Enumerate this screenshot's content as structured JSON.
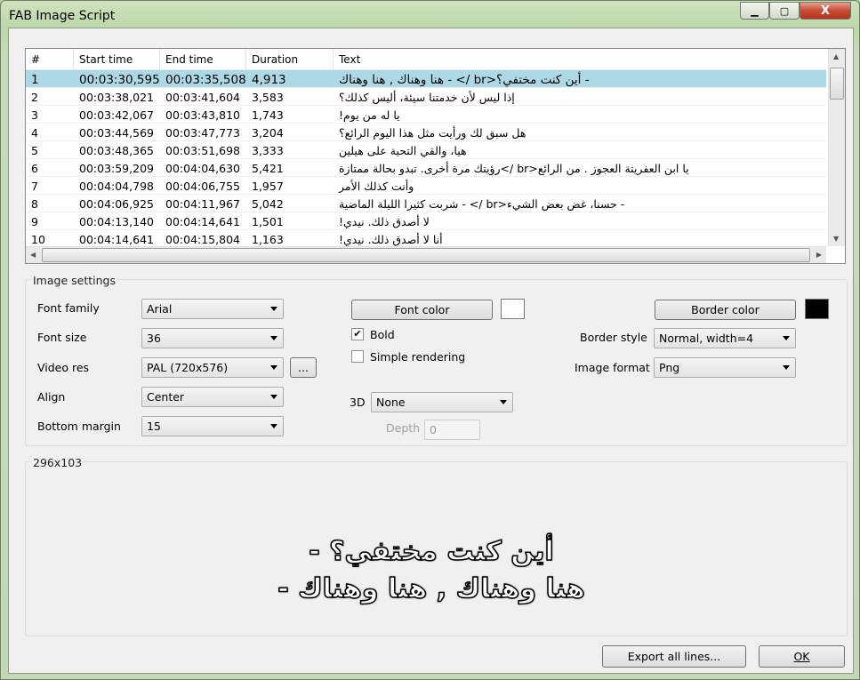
{
  "window": {
    "title": "FAB Image Script",
    "close_glyph": "X"
  },
  "list": {
    "columns": [
      "#",
      "Start time",
      "End time",
      "Duration",
      "Text"
    ],
    "rows": [
      {
        "n": "1",
        "start": "00:03:30,595",
        "end": "00:03:35,508",
        "dur": "4,913",
        "text": "- أين كنت مختفي؟<br /> - هنا وهناك , هنا وهناك"
      },
      {
        "n": "2",
        "start": "00:03:38,021",
        "end": "00:03:41,604",
        "dur": "3,583",
        "text": "إذا ليس لأن خدمتنا سيئة، أليس كذلك؟"
      },
      {
        "n": "3",
        "start": "00:03:42,067",
        "end": "00:03:43,810",
        "dur": "1,743",
        "text": "يا له من يوم!"
      },
      {
        "n": "4",
        "start": "00:03:44,569",
        "end": "00:03:47,773",
        "dur": "3,204",
        "text": "هل سبق لك ورأيت مثل هذا اليوم الرائع؟"
      },
      {
        "n": "5",
        "start": "00:03:48,365",
        "end": "00:03:51,698",
        "dur": "3,333",
        "text": "هيا، والقي التحية على هيلين"
      },
      {
        "n": "6",
        "start": "00:03:59,209",
        "end": "00:04:04,630",
        "dur": "5,421",
        "text": "يا ابن العفريتة العجوز . من الرائع<br />رؤيتك مرة أخرى. تبدو بحالة ممتازة"
      },
      {
        "n": "7",
        "start": "00:04:04,798",
        "end": "00:04:06,755",
        "dur": "1,957",
        "text": "وأنت كذلك الأمر"
      },
      {
        "n": "8",
        "start": "00:04:06,925",
        "end": "00:04:11,967",
        "dur": "5,042",
        "text": "- حسنا، غض بعض الشيء<br /> - شربت كثيرا الليلة الماضية"
      },
      {
        "n": "9",
        "start": "00:04:13,140",
        "end": "00:04:14,641",
        "dur": "1,501",
        "text": "لا أصدق ذلك. نيدي!"
      },
      {
        "n": "10",
        "start": "00:04:14,641",
        "end": "00:04:15,804",
        "dur": "1,163",
        "text": "أنا لا أصدق ذلك. نيدي!"
      }
    ]
  },
  "settings": {
    "group_label": "Image settings",
    "font_family_label": "Font family",
    "font_family": "Arial",
    "font_size_label": "Font size",
    "font_size": "36",
    "video_res_label": "Video res",
    "video_res": "PAL (720x576)",
    "video_res_more": "...",
    "align_label": "Align",
    "align": "Center",
    "bottom_margin_label": "Bottom margin",
    "bottom_margin": "15",
    "font_color_button": "Font color",
    "font_color": "#ffffff",
    "bold_label": "Bold",
    "bold_checked": true,
    "simple_label": "Simple rendering",
    "simple_checked": false,
    "three_d_label": "3D",
    "three_d": "None",
    "depth_label": "Depth",
    "depth": "0",
    "border_color_button": "Border color",
    "border_color": "#000000",
    "border_style_label": "Border style",
    "border_style": "Normal, width=4",
    "image_format_label": "Image format",
    "image_format": "Png"
  },
  "preview": {
    "size": "296x103",
    "line1": "أين كنت مختفي؟ -",
    "line2": "هنا وهناك , هنا وهناك -"
  },
  "footer": {
    "export": "Export all lines...",
    "ok": "OK"
  }
}
